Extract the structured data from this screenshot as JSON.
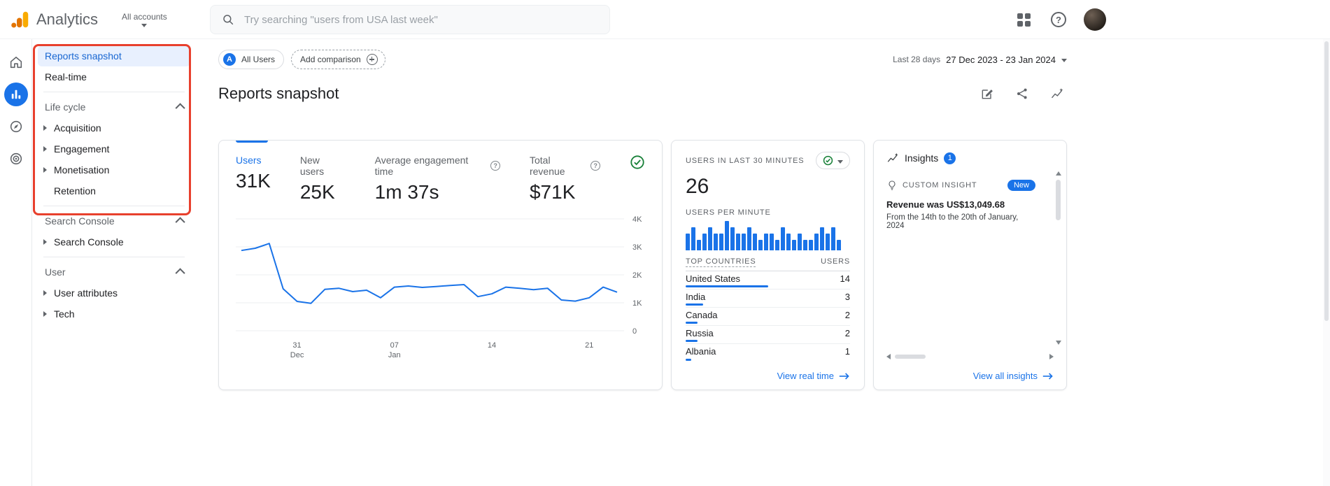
{
  "topbar": {
    "app_name": "Analytics",
    "accounts_label": "All accounts",
    "search_placeholder": "Try searching \"users from USA last week\""
  },
  "icons": {
    "question_mark": "?"
  },
  "colors": {
    "accent": "#1a73e8",
    "selected_bg": "#e8f0fe",
    "green": "#188038",
    "annotation": "#e8402d",
    "text_primary": "#202124",
    "text_secondary": "#5f6368"
  },
  "sidebar": {
    "items": [
      {
        "label": "Reports snapshot"
      },
      {
        "label": "Real-time"
      }
    ],
    "sections": [
      {
        "title": "Life cycle",
        "children": [
          "Acquisition",
          "Engagement",
          "Monetisation",
          "Retention"
        ]
      },
      {
        "title": "Search Console",
        "children": [
          "Search Console"
        ]
      },
      {
        "title": "User",
        "children": [
          "User attributes",
          "Tech"
        ]
      }
    ]
  },
  "header": {
    "audience_initial": "A",
    "audience_chip": "All Users",
    "comparison_chip": "Add comparison",
    "date_label": "Last 28 days",
    "date_range": "27 Dec 2023 - 23 Jan 2024",
    "page_title": "Reports snapshot"
  },
  "overview": {
    "metrics": [
      {
        "label": "Users",
        "value": "31K"
      },
      {
        "label": "New users",
        "value": "25K"
      },
      {
        "label": "Average engagement time",
        "value": "1m 37s"
      },
      {
        "label": "Total revenue",
        "value": "$71K"
      }
    ],
    "chart_data": {
      "type": "line",
      "series": [
        {
          "name": "Users",
          "values": [
            2870,
            2950,
            3120,
            1500,
            1050,
            980,
            1480,
            1520,
            1400,
            1450,
            1180,
            1560,
            1600,
            1550,
            1580,
            1620,
            1650,
            1220,
            1320,
            1560,
            1520,
            1470,
            1520,
            1100,
            1060,
            1180,
            1560,
            1380
          ]
        }
      ],
      "x_ticks": [
        {
          "index": 4,
          "label": "31",
          "sub": "Dec"
        },
        {
          "index": 11,
          "label": "07",
          "sub": "Jan"
        },
        {
          "index": 18,
          "label": "14"
        },
        {
          "index": 25,
          "label": "21"
        }
      ],
      "y_ticks": [
        "4K",
        "3K",
        "2K",
        "1K",
        "0"
      ],
      "ylim": [
        0,
        4000
      ],
      "grid": true
    }
  },
  "realtime": {
    "title": "USERS IN LAST 30 MINUTES",
    "value": "26",
    "per_minute_label": "USERS PER MINUTE",
    "per_minute_values": [
      2,
      3,
      1,
      2,
      3,
      2,
      2,
      4,
      3,
      2,
      2,
      3,
      2,
      1,
      2,
      2,
      1,
      3,
      2,
      1,
      2,
      1,
      1,
      2,
      3,
      2,
      3,
      1
    ],
    "countries_header": {
      "left": "TOP COUNTRIES",
      "right": "USERS"
    },
    "countries": [
      {
        "name": "United States",
        "users": "14",
        "bar": 14
      },
      {
        "name": "India",
        "users": "3",
        "bar": 3
      },
      {
        "name": "Canada",
        "users": "2",
        "bar": 2
      },
      {
        "name": "Russia",
        "users": "2",
        "bar": 2
      },
      {
        "name": "Albania",
        "users": "1",
        "bar": 1
      }
    ],
    "link": "View real time"
  },
  "insights": {
    "title": "Insights",
    "badge": "1",
    "section_label": "CUSTOM INSIGHT",
    "new_badge": "New",
    "headline": "Revenue was US$13,049.68",
    "subtext": "From the 14th to the 20th of January, 2024",
    "link": "View all insights"
  }
}
